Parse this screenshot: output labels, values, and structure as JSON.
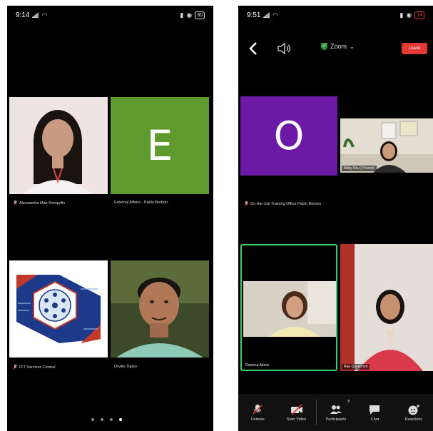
{
  "left_phone": {
    "status": {
      "time": "9:14",
      "battery": "30"
    },
    "tiles": [
      {
        "name": "Alessandra Mae Ronquillo"
      },
      {
        "name": "External Affairs - Pablo Borbon",
        "letter": "E"
      },
      {
        "name": "ICT Services Central"
      },
      {
        "name": "Orville Tiglao"
      }
    ]
  },
  "right_phone": {
    "status": {
      "time": "9:51",
      "battery": "14"
    },
    "header": {
      "zoom_label": "Zoom",
      "leave_label": "Leave"
    },
    "tiles": [
      {
        "name": "On-the-Job Training Office Pablo Borbon",
        "letter": "O"
      },
      {
        "name": "Abby Ocu | Prosole"
      },
      {
        "name": "Rowena Abrea"
      },
      {
        "name": "Rae Quiatchon"
      }
    ],
    "toolbar": [
      "Unmute",
      "Start Video",
      "Participants",
      "Chat",
      "Reactions"
    ],
    "participants_count": "8"
  },
  "colors": {
    "green_tile": "#5f9a2e",
    "purple_tile": "#6c1aa6",
    "leave_red": "#e53935",
    "active_border": "#3ecb6a"
  }
}
